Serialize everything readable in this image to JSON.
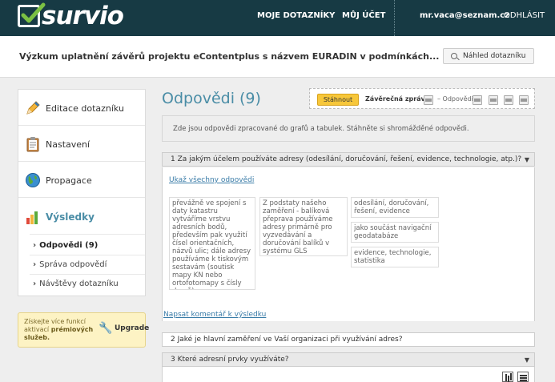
{
  "brand": {
    "logo_text": "survio"
  },
  "topnav": {
    "items": [
      "MOJE DOTAZNÍKY",
      "MŮJ ÚČET"
    ],
    "user_email": "mr.vaca@seznam.cz",
    "logout": "ODHLÁSIT"
  },
  "header": {
    "survey_title": "Výzkum uplatnění závěrů projektu eContentplus s názvem EURADIN v podmínkách...",
    "preview_button": "Náhled dotazníku"
  },
  "sidebar": {
    "items": [
      {
        "label": "Editace dotazníku",
        "icon": "pencil-icon"
      },
      {
        "label": "Nastavení",
        "icon": "clipboard-icon"
      },
      {
        "label": "Propagace",
        "icon": "globe-icon"
      },
      {
        "label": "Výsledky",
        "icon": "bar-chart-icon"
      }
    ],
    "subitems": [
      "Odpovědi (9)",
      "Správa odpovědí",
      "Návštěvy dotazníku"
    ]
  },
  "promo": {
    "text_before": "Získejte více funkcí",
    "text_middle": "aktivací ",
    "text_bold": "prémiových služeb.",
    "upgrade_label": "Upgrade"
  },
  "main": {
    "title": "Odpovědi (9)",
    "report": {
      "download_button": "Stáhnout",
      "final_report": "Závěrečná zpráva",
      "dash_label": "– Odpovědi"
    },
    "info": "Zde jsou odpovědi zpracované do grafů a tabulek. Stáhněte si shromážděné odpovědi.",
    "questions": [
      {
        "title": "1 Za jakým účelem používáte adresy (odesílání, doručování, řešení, evidence, technologie, atp.)?"
      },
      {
        "title": "2 Jaké je hlavní zaměření ve Vaší organizaci při využívání adres?"
      },
      {
        "title": "3 Které adresní prvky využíváte?"
      }
    ],
    "show_all_link": "Ukaž všechny odpovědi",
    "answers": [
      "převážně ve spojení s daty katastru vytváříme vrstvu adresních bodů, především pak využití čísel orientačních, názvů ulic; dále adresy používáme k tiskovým sestavám (soutisk mapy KN nebo ortofotomapy s čísly domů)",
      "Z podstaty našeho zaměření - balíková přeprava používáme adresy primárně pro vyzvedávání a doručování balíků v systému GLS",
      "odesílání, doručování, řešení, evidence",
      "jako součást navigační geodatabáze",
      "evidence, technologie, statistika"
    ],
    "comment_link": "Napsat komentář k výsledku"
  },
  "colors": {
    "topbar": "#173a44",
    "accent": "#4a8da6",
    "download_button": "#f7c73a",
    "promo_bg": "#fdf3c4"
  }
}
